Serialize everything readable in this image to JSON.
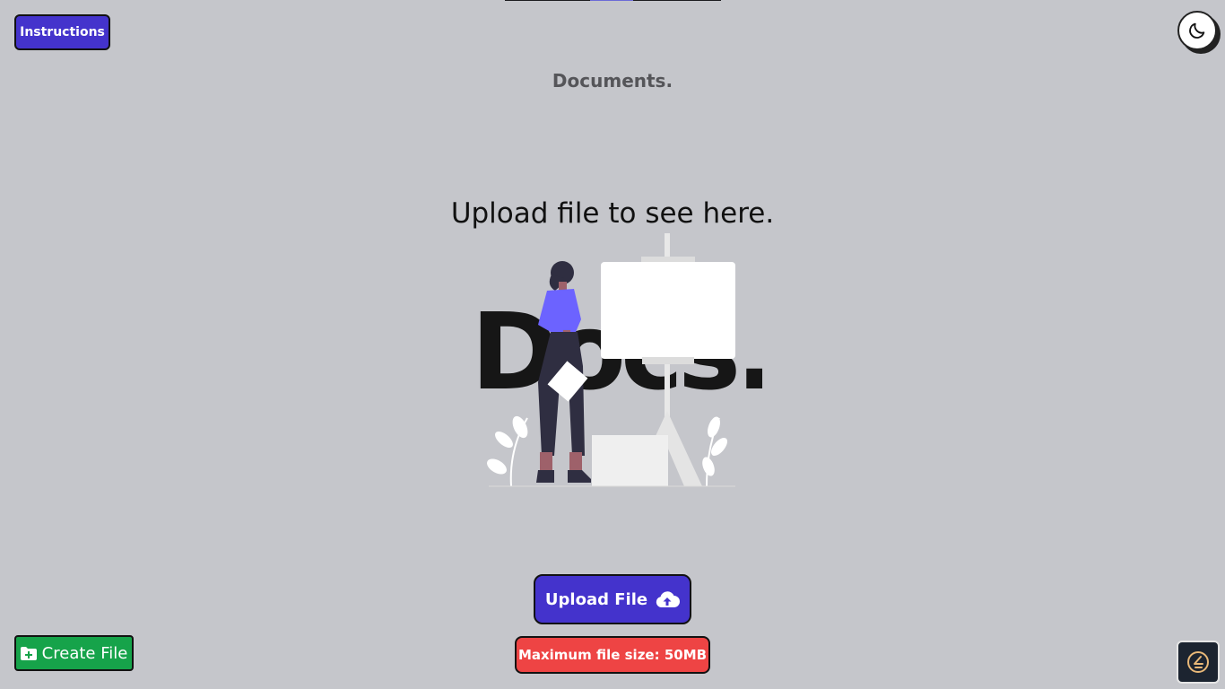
{
  "header": {
    "instructions_label": "Instructions",
    "brand": "Documents.",
    "theme_icon": "moon-icon"
  },
  "main": {
    "empty_message": "Upload file to see here.",
    "illustration_text": "Docs."
  },
  "actions": {
    "upload_label": "Upload File",
    "upload_icon": "cloud-upload-icon",
    "max_size_label": "Maximum file size: 50MB",
    "create_label": "Create File",
    "create_icon": "folder-plus-icon"
  },
  "colors": {
    "background": "#c5c6cb",
    "accent": "#4433cc",
    "danger": "#ee4444",
    "success": "#16a34a"
  }
}
